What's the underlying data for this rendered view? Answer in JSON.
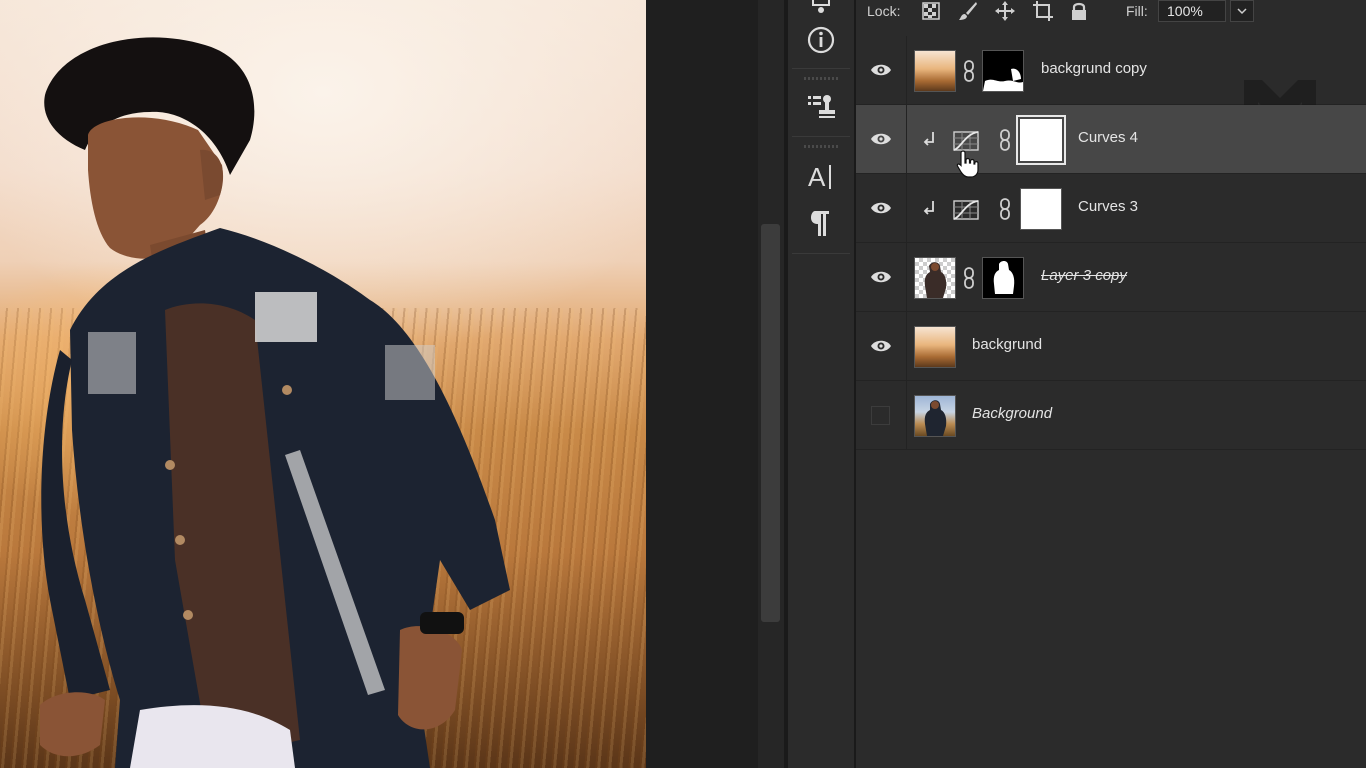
{
  "lock_bar": {
    "lock_label": "Lock:",
    "fill_label": "Fill:",
    "fill_value": "100%"
  },
  "layers": [
    {
      "name": "backgrund copy",
      "visible": true,
      "selected": false,
      "thumb": "warm-photo",
      "has_mask": true,
      "italic": false
    },
    {
      "name": "Curves 4",
      "visible": true,
      "selected": true,
      "type": "curves-adjustment",
      "clipped": true
    },
    {
      "name": "Curves 3",
      "visible": true,
      "selected": false,
      "type": "curves-adjustment",
      "clipped": true
    },
    {
      "name": "Layer 3 copy",
      "visible": true,
      "selected": false,
      "thumb": "cutout-person",
      "has_mask": true,
      "strikethrough": true
    },
    {
      "name": "backgrund",
      "visible": true,
      "selected": false,
      "thumb": "warm-photo"
    },
    {
      "name": "Background",
      "visible": false,
      "selected": false,
      "thumb": "original-photo",
      "italic": true
    }
  ],
  "tool_strip": [
    "layer-comps-icon",
    "info-icon",
    "clone-source-icon",
    "character-icon",
    "paragraph-icon"
  ],
  "colors": {
    "panel_bg": "#2b2b2b",
    "selected_row": "#474747",
    "app_bg": "#1e1e1e"
  }
}
